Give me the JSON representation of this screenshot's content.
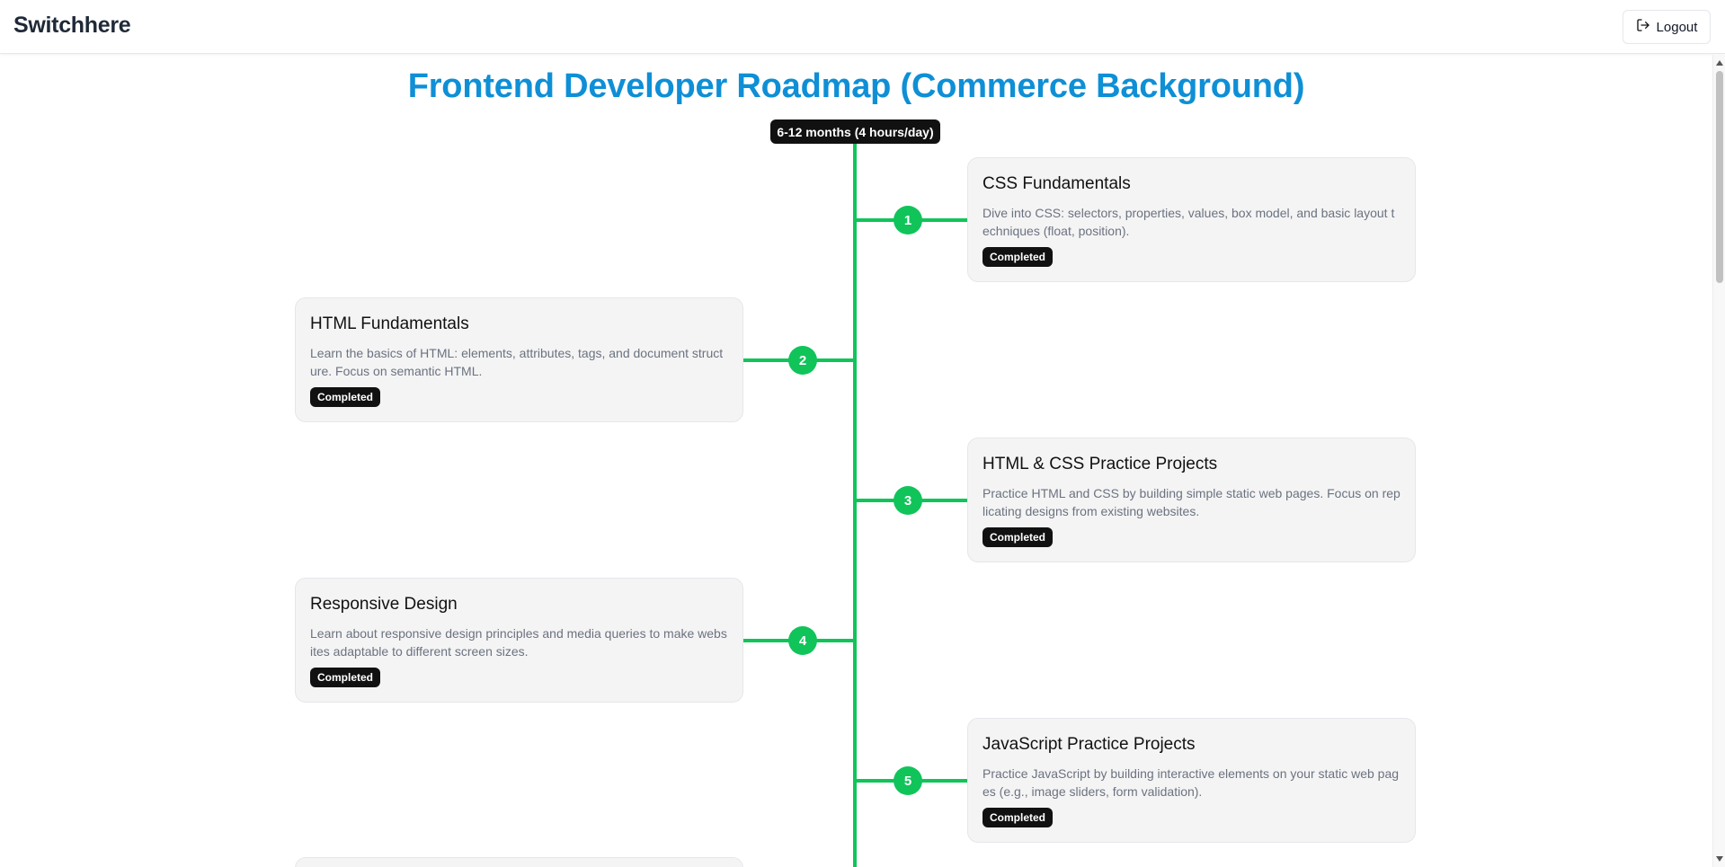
{
  "header": {
    "brand": "Switchhere",
    "logout_label": "Logout"
  },
  "page": {
    "title": "Frontend Developer Roadmap (Commerce Background)",
    "duration": "6-12 months (4 hours/day)"
  },
  "colors": {
    "title": "#0e8fd6",
    "timeline": "#10c45a",
    "badge_bg": "#111111"
  },
  "steps": [
    {
      "number": "1",
      "side": "right",
      "title": "CSS Fundamentals",
      "description": "Dive into CSS: selectors, properties, values, box model, and basic layout techniques (float, position).",
      "status": "Completed"
    },
    {
      "number": "2",
      "side": "left",
      "title": "HTML Fundamentals",
      "description": "Learn the basics of HTML: elements, attributes, tags, and document structure. Focus on semantic HTML.",
      "status": "Completed"
    },
    {
      "number": "3",
      "side": "right",
      "title": "HTML & CSS Practice Projects",
      "description": "Practice HTML and CSS by building simple static web pages. Focus on replicating designs from existing websites.",
      "status": "Completed"
    },
    {
      "number": "4",
      "side": "left",
      "title": "Responsive Design",
      "description": "Learn about responsive design principles and media queries to make websites adaptable to different screen sizes.",
      "status": "Completed"
    },
    {
      "number": "5",
      "side": "right",
      "title": "JavaScript Practice Projects",
      "description": "Practice JavaScript by building interactive elements on your static web pages (e.g., image sliders, form validation).",
      "status": "Completed"
    }
  ]
}
